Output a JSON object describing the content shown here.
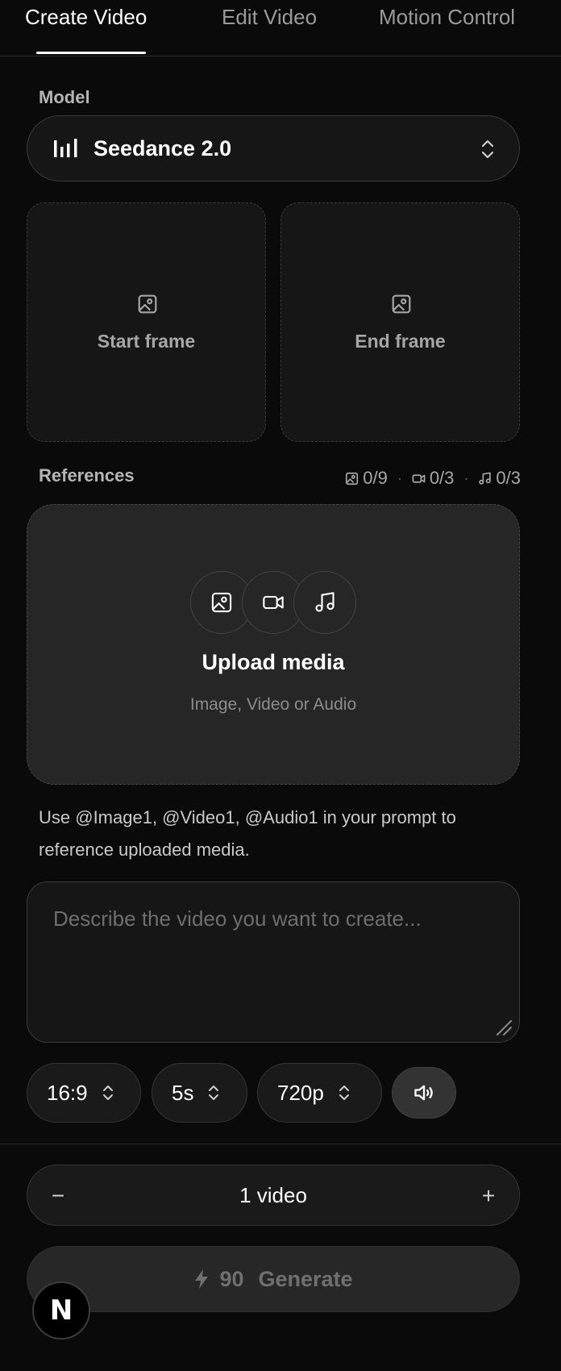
{
  "tabs": [
    {
      "label": "Create Video",
      "active": true
    },
    {
      "label": "Edit Video",
      "active": false
    },
    {
      "label": "Motion Control",
      "active": false
    }
  ],
  "model": {
    "label": "Model",
    "selected": "Seedance 2.0"
  },
  "frames": {
    "start_label": "Start frame",
    "end_label": "End frame"
  },
  "references": {
    "label": "References",
    "images": "0/9",
    "videos": "0/3",
    "audio": "0/3"
  },
  "upload": {
    "title": "Upload media",
    "subtitle": "Image, Video or Audio"
  },
  "hint": "Use @Image1, @Video1, @Audio1 in your prompt to reference uploaded media.",
  "prompt": {
    "value": "",
    "placeholder": "Describe the video you want to create..."
  },
  "options": {
    "aspect_ratio": "16:9",
    "duration": "5s",
    "resolution": "720p"
  },
  "count": {
    "label": "1 video",
    "minus": "−",
    "plus": "+"
  },
  "generate": {
    "cost": "90",
    "label": "Generate"
  },
  "badge": {
    "letter": "N"
  },
  "colors": {
    "background": "#0a0a0a",
    "surface": "#161616",
    "upload_surface": "#262626",
    "border": "#3a3a3a",
    "text_primary": "#ffffff",
    "text_muted": "#a6a6a6"
  },
  "icons": [
    "bars-icon",
    "chevron-updown-icon",
    "image-icon",
    "video-icon",
    "music-icon",
    "speaker-icon",
    "lightning-icon",
    "resize-grip-icon"
  ]
}
